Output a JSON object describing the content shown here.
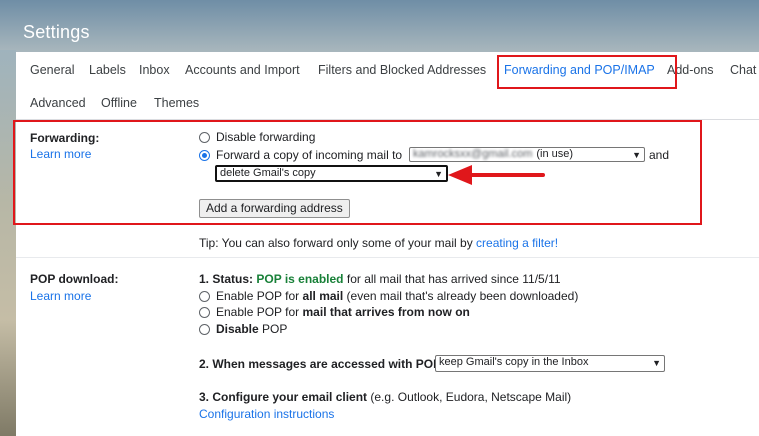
{
  "header": {
    "title": "Settings"
  },
  "tabs": [
    {
      "label": "General"
    },
    {
      "label": "Labels"
    },
    {
      "label": "Inbox"
    },
    {
      "label": "Accounts and Import"
    },
    {
      "label": "Filters and Blocked Addresses"
    },
    {
      "label": "Forwarding and POP/IMAP"
    },
    {
      "label": "Add-ons"
    },
    {
      "label": "Chat"
    },
    {
      "label": "Advanced"
    },
    {
      "label": "Offline"
    },
    {
      "label": "Themes"
    }
  ],
  "forwarding": {
    "label": "Forwarding:",
    "learn_more": "Learn more",
    "option_disable": "Disable forwarding",
    "option_forward": "Forward a copy of incoming mail to",
    "address_value": "kamrocksxx@gmail.com",
    "address_suffix": "(in use)",
    "and_text": "and",
    "action_value": "delete Gmail's copy",
    "add_button": "Add a forwarding address",
    "tip_prefix": "Tip: You can also forward only some of your mail by",
    "tip_link": "creating a filter!"
  },
  "pop": {
    "label": "POP download:",
    "learn_more": "Learn more",
    "status_prefix": "1. Status:",
    "status_value": "POP is enabled",
    "status_suffix": "for all mail that has arrived since 11/5/11",
    "opt1_prefix": "Enable POP for",
    "opt1_bold": "all mail",
    "opt1_suffix": "(even mail that's already been downloaded)",
    "opt2_prefix": "Enable POP for",
    "opt2_bold": "mail that arrives from now on",
    "opt3": "Disable",
    "opt3_suffix": "POP",
    "when_label": "2. When messages are accessed with POP",
    "when_value": "keep Gmail's copy in the Inbox",
    "configure_label": "3. Configure your email client",
    "configure_suffix": "(e.g. Outlook, Eudora, Netscape Mail)",
    "configure_link": "Configuration instructions"
  },
  "colors": {
    "highlight": "#e0171b",
    "link": "#1a73e8",
    "status_green": "#188038"
  },
  "icons": {
    "dropdown": "chevron-down-icon",
    "annotation": "red-arrow-icon"
  }
}
